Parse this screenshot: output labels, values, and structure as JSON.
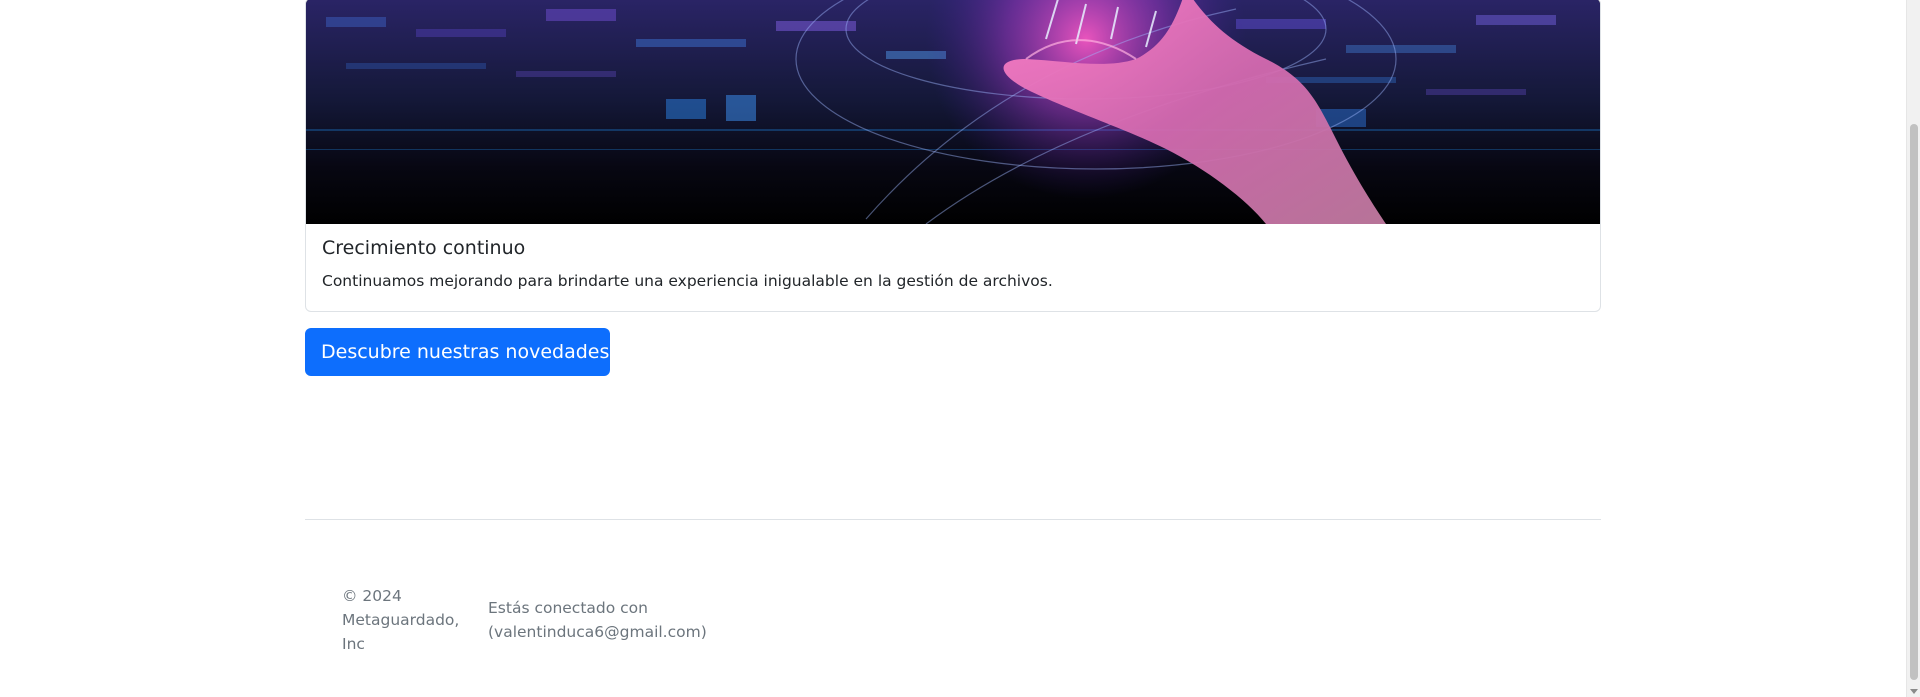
{
  "card": {
    "image_alt": "digital-hand-illustration",
    "title": "Crecimiento continuo",
    "text": "Continuamos mejorando para brindarte una experiencia inigualable en la gestión de archivos."
  },
  "cta": {
    "label": "Descubre nuestras novedades"
  },
  "footer": {
    "copyright": "© 2024 Metaguardado, Inc",
    "connected_line1": "Estás conectado con",
    "connected_line2": "(valentinduca6@gmail.com)"
  },
  "colors": {
    "primary": "#0d6efd",
    "muted_text": "#6c757d",
    "border": "#dee2e6"
  }
}
